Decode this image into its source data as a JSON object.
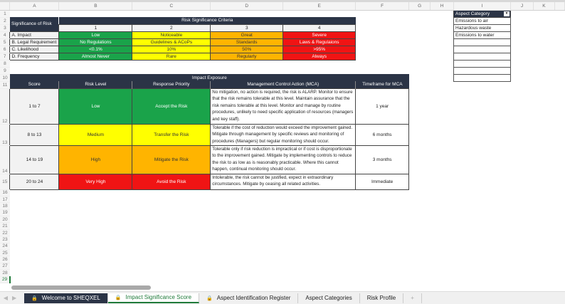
{
  "columns": [
    "A",
    "B",
    "C",
    "D",
    "E",
    "F",
    "G",
    "H",
    "I",
    "J",
    "K"
  ],
  "rows": [
    "1",
    "2",
    "3",
    "4",
    "5",
    "6",
    "7",
    "8",
    "9",
    "10",
    "11",
    "12",
    "13",
    "14",
    "15",
    "16",
    "17",
    "18",
    "19",
    "20",
    "21",
    "22",
    "23",
    "24",
    "25",
    "26",
    "27",
    "28",
    "29"
  ],
  "criteria": {
    "corner": "Significance of Risk",
    "title": "Risk Significance Criteria",
    "levels": [
      "1",
      "2",
      "3",
      "4"
    ],
    "rows": [
      {
        "label": "A. Impact",
        "values": [
          "Low",
          "Noticeable",
          "Great",
          "Severe"
        ]
      },
      {
        "label": "B. Legal Requirement",
        "values": [
          "No Regulations",
          "Guidelines & ACoPs",
          "Standards",
          "Laws & Regulaions"
        ]
      },
      {
        "label": "C. Likelihood",
        "values": [
          "<0.1%",
          "10%",
          "50%",
          ">95%"
        ]
      },
      {
        "label": "D. Frequency",
        "values": [
          "Almost Never",
          "Rare",
          "Regularly",
          "Always"
        ]
      }
    ]
  },
  "exposure": {
    "title": "Impact Exposure",
    "headers": [
      "Score",
      "Risk Level",
      "Response Priority",
      "Management Control Action (MCA)",
      "Timeframe for MCA"
    ],
    "rows": [
      {
        "score": "1 to 7",
        "level": "Low",
        "priority": "Accept the Risk",
        "mca": "No mitigation, no action is required, the risk is ALARP. Monitor to ensure that the risk remains tolerable at this level. Maintain assurance that the risk remains tolerable at this level. Monitor and manage by routine procedures, unlikely to need specific application of resources (managers and key staff).",
        "time": "1 year"
      },
      {
        "score": "8 to 13",
        "level": "Medium",
        "priority": "Transfer the Risk",
        "mca": "Tolerable if the cost of reduction would exceed the improvement gained. Mitigate through management by specific reviews and monitoring of procedures (Managers) but regular monitoring should occur.",
        "time": "6 months"
      },
      {
        "score": "14 to 19",
        "level": "High",
        "priority": "Mitigate the Risk",
        "mca": "Tolerable only if risk reduction is impractical or if cost is disproportionate to the improvement gained. Mitigate by implementing controls to reduce the risk to as low as is reasonably practicable. Where this cannot happen, continual monitoring should occur.",
        "time": "3 months"
      },
      {
        "score": "20 to 24",
        "level": "Very High",
        "priority": "Avoid the Risk",
        "mca": "Intolerable, the risk cannot be justified, expect in extraordinary circumstances. Mitigate by ceasing all related activities.",
        "time": "Immediate"
      }
    ]
  },
  "aspects": {
    "header": "Aspect Category",
    "items": [
      "Emissions to air",
      "Hazardous waste",
      "Emissions to water"
    ]
  },
  "tabs": [
    "Welcome to SHEQXEL",
    "Impact Significance Score",
    "Aspect Identification Register",
    "Aspect Categories",
    "Risk Profile"
  ],
  "add_tab": "+"
}
